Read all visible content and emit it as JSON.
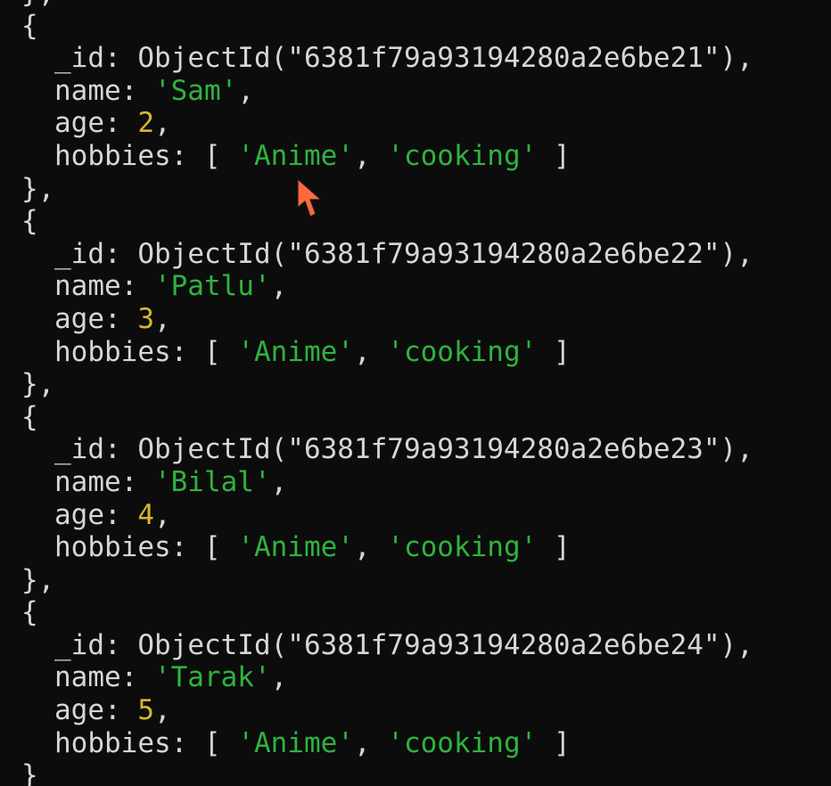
{
  "terminal": {
    "partial_top": "},",
    "documents": [
      {
        "id": "ObjectId(\"6381f79a93194280a2e6be21\")",
        "name": "'Sam'",
        "age": "2",
        "hobbies": [
          "'Anime'",
          "'cooking'"
        ],
        "close": "},"
      },
      {
        "id": "ObjectId(\"6381f79a93194280a2e6be22\")",
        "name": "'Patlu'",
        "age": "3",
        "hobbies": [
          "'Anime'",
          "'cooking'"
        ],
        "close": "},"
      },
      {
        "id": "ObjectId(\"6381f79a93194280a2e6be23\")",
        "name": "'Bilal'",
        "age": "4",
        "hobbies": [
          "'Anime'",
          "'cooking'"
        ],
        "close": "},"
      },
      {
        "id": "ObjectId(\"6381f79a93194280a2e6be24\")",
        "name": "'Tarak'",
        "age": "5",
        "hobbies": [
          "'Anime'",
          "'cooking'"
        ],
        "close": "}"
      }
    ],
    "keys": {
      "id": "_id",
      "name": "name",
      "age": "age",
      "hobbies": "hobbies"
    },
    "punctuation": {
      "open_brace": "{",
      "colon": ": ",
      "comma": ",",
      "array_open": "[ ",
      "array_sep": ", ",
      "array_close": " ]"
    }
  },
  "colors": {
    "background": "#0c0c0c",
    "text": "#d6d6d6",
    "string": "#2fb33f",
    "number": "#d6b62c",
    "cursor": "#ff6a3d"
  },
  "icons": {
    "cursor": "mouse-pointer-icon"
  }
}
